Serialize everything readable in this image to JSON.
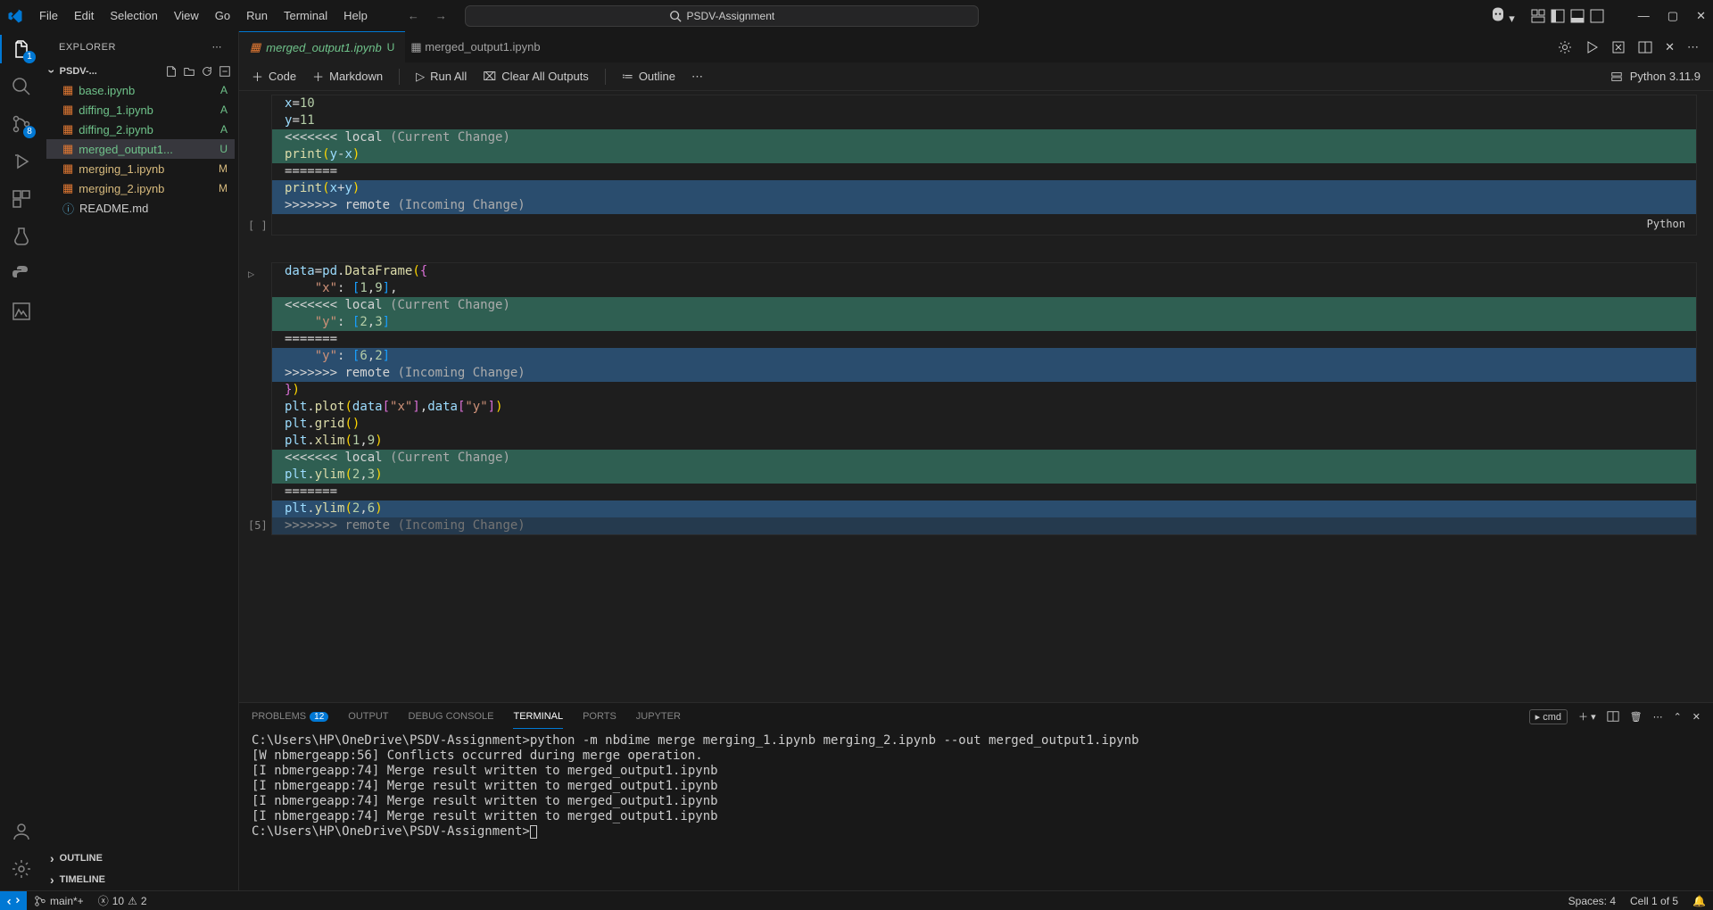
{
  "menu": [
    "File",
    "Edit",
    "Selection",
    "View",
    "Go",
    "Run",
    "Terminal",
    "Help"
  ],
  "title": "PSDV-Assignment",
  "activity": {
    "explorer_badge": "1",
    "scm_badge": "8"
  },
  "sidebar": {
    "title": "EXPLORER",
    "root": "PSDV-...",
    "files": [
      {
        "name": "base.ipynb",
        "status": "A",
        "cls": "added"
      },
      {
        "name": "diffing_1.ipynb",
        "status": "A",
        "cls": "added"
      },
      {
        "name": "diffing_2.ipynb",
        "status": "A",
        "cls": "added"
      },
      {
        "name": "merged_output1...",
        "status": "U",
        "cls": "untracked active"
      },
      {
        "name": "merging_1.ipynb",
        "status": "M",
        "cls": "modified"
      },
      {
        "name": "merging_2.ipynb",
        "status": "M",
        "cls": "modified"
      },
      {
        "name": "README.md",
        "status": "",
        "cls": ""
      }
    ],
    "outline": "OUTLINE",
    "timeline": "TIMELINE"
  },
  "tab": {
    "name": "merged_output1.ipynb",
    "status": "U",
    "breadcrumb": "merged_output1.ipynb"
  },
  "toolbar": {
    "code": "Code",
    "markdown": "Markdown",
    "runall": "Run All",
    "clear": "Clear All Outputs",
    "outline": "Outline",
    "kernel": "Python 3.11.9"
  },
  "cell1": {
    "exec": "[ ]",
    "lang": "Python",
    "lines": {
      "l1a": "x",
      "l1b": "=",
      "l1c": "10",
      "l2a": "y",
      "l2b": "=",
      "l2c": "11",
      "l3a": "<<<<<<< ",
      "l3b": "local",
      "l3c": " (Current Change)",
      "l4a": "print",
      "l4b": "(",
      "l4c": "y",
      "l4d": "-",
      "l4e": "x",
      "l4f": ")",
      "l5": "=======",
      "l6a": "print",
      "l6b": "(",
      "l6c": "x",
      "l6d": "+",
      "l6e": "y",
      "l6f": ")",
      "l7a": ">>>>>>> ",
      "l7b": "remote",
      "l7c": " (Incoming Change)"
    }
  },
  "cell2": {
    "exec": "[5]",
    "lines": {
      "l1": "data=pd.DataFrame({",
      "l2": "    \"x\": [1,9],",
      "l3a": "<<<<<<< ",
      "l3b": "local",
      "l3c": " (Current Change)",
      "l4": "    \"y\": [2,3]",
      "l5": "=======",
      "l6": "    \"y\": [6,2]",
      "l7a": ">>>>>>> ",
      "l7b": "remote",
      "l7c": " (Incoming Change)",
      "l8": "})",
      "l9": "plt.plot(data[\"x\"],data[\"y\"])",
      "l10": "plt.grid()",
      "l11": "plt.xlim(1,9)",
      "l12a": "<<<<<<< ",
      "l12b": "local",
      "l12c": " (Current Change)",
      "l13": "plt.ylim(2,3)",
      "l14": "=======",
      "l15": "plt.ylim(2,6)",
      "l16a": ">>>>>>> ",
      "l16b": "remote",
      "l16c": " (Incoming Change)"
    }
  },
  "panel": {
    "tabs": [
      "PROBLEMS",
      "OUTPUT",
      "DEBUG CONSOLE",
      "TERMINAL",
      "PORTS",
      "JUPYTER"
    ],
    "problems_count": "12",
    "shell": "cmd",
    "terminal": [
      "C:\\Users\\HP\\OneDrive\\PSDV-Assignment>python -m nbdime merge merging_1.ipynb merging_2.ipynb --out merged_output1.ipynb",
      "[W nbmergeapp:56] Conflicts occurred during merge operation.",
      "[I nbmergeapp:74] Merge result written to merged_output1.ipynb",
      "",
      "[I nbmergeapp:74] Merge result written to merged_output1.ipynb",
      "[I nbmergeapp:74] Merge result written to merged_output1.ipynb",
      "[I nbmergeapp:74] Merge result written to merged_output1.ipynb",
      "",
      "C:\\Users\\HP\\OneDrive\\PSDV-Assignment>"
    ]
  },
  "status": {
    "branch": "main*+",
    "errors": "10",
    "warnings": "2",
    "spaces": "Spaces: 4",
    "cell": "Cell 1 of 5"
  }
}
